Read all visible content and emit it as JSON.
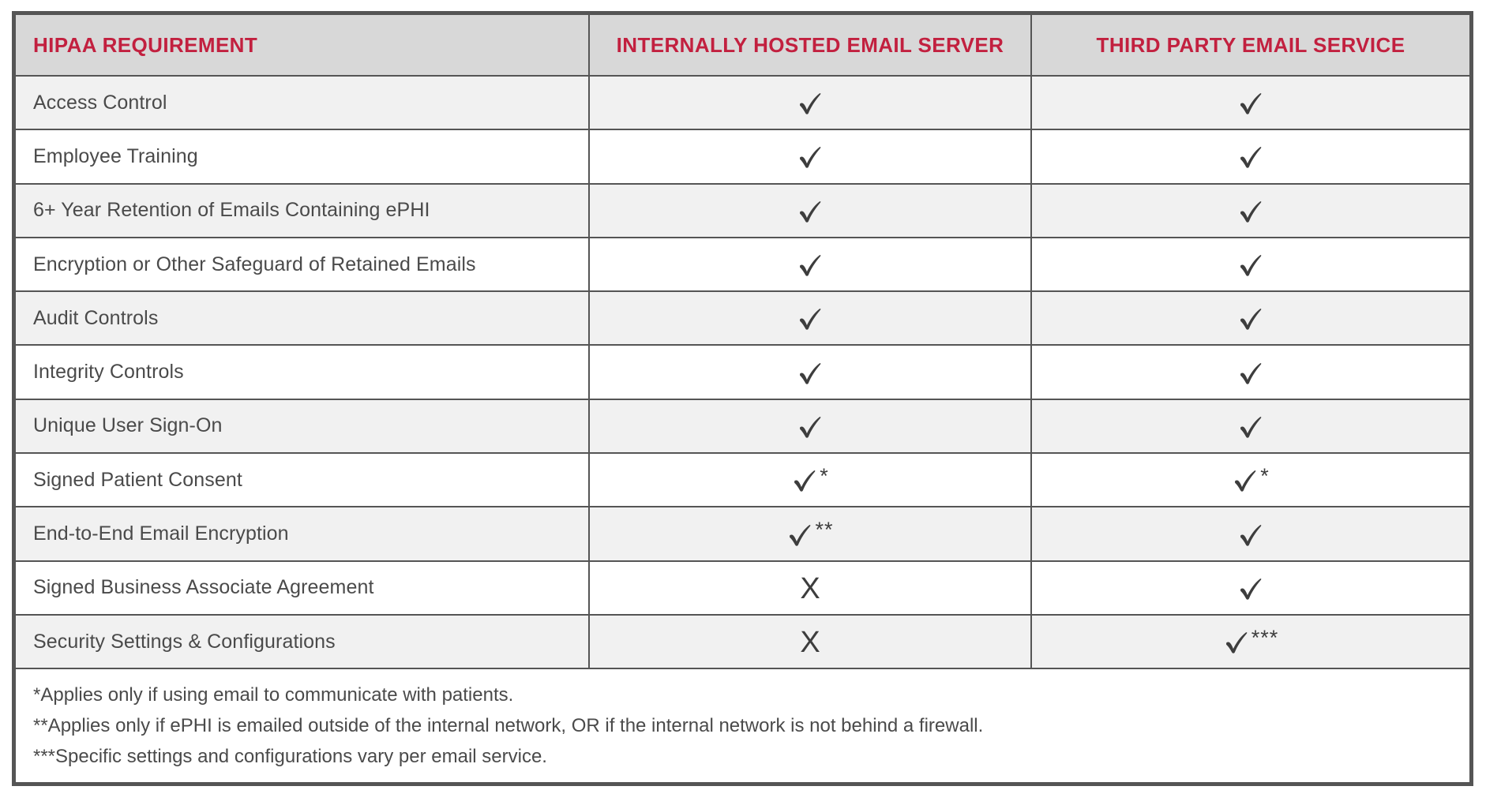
{
  "table": {
    "headers": {
      "requirement": "HIPAA Requirement",
      "internal": "Internally Hosted Email Server",
      "third_party": "Third Party Email Service"
    },
    "header_color": "#c2203f",
    "header_background": "#d8d8d8",
    "border_color": "#555555",
    "stripe_color": "#f1f1f1",
    "mark_color": "#3d3d3d",
    "rows": [
      {
        "requirement": "Access Control",
        "internal": {
          "mark": "check",
          "note": ""
        },
        "third_party": {
          "mark": "check",
          "note": ""
        }
      },
      {
        "requirement": "Employee Training",
        "internal": {
          "mark": "check",
          "note": ""
        },
        "third_party": {
          "mark": "check",
          "note": ""
        }
      },
      {
        "requirement": "6+ Year Retention of Emails Containing ePHI",
        "internal": {
          "mark": "check",
          "note": ""
        },
        "third_party": {
          "mark": "check",
          "note": ""
        }
      },
      {
        "requirement": "Encryption or Other Safeguard of Retained Emails",
        "internal": {
          "mark": "check",
          "note": ""
        },
        "third_party": {
          "mark": "check",
          "note": ""
        }
      },
      {
        "requirement": "Audit Controls",
        "internal": {
          "mark": "check",
          "note": ""
        },
        "third_party": {
          "mark": "check",
          "note": ""
        }
      },
      {
        "requirement": "Integrity Controls",
        "internal": {
          "mark": "check",
          "note": ""
        },
        "third_party": {
          "mark": "check",
          "note": ""
        }
      },
      {
        "requirement": "Unique User Sign-On",
        "internal": {
          "mark": "check",
          "note": ""
        },
        "third_party": {
          "mark": "check",
          "note": ""
        }
      },
      {
        "requirement": "Signed Patient Consent",
        "internal": {
          "mark": "check",
          "note": "*"
        },
        "third_party": {
          "mark": "check",
          "note": "*"
        }
      },
      {
        "requirement": "End-to-End Email Encryption",
        "internal": {
          "mark": "check",
          "note": "**"
        },
        "third_party": {
          "mark": "check",
          "note": ""
        }
      },
      {
        "requirement": "Signed Business Associate Agreement",
        "internal": {
          "mark": "x",
          "note": ""
        },
        "third_party": {
          "mark": "check",
          "note": ""
        }
      },
      {
        "requirement": "Security Settings & Configurations",
        "internal": {
          "mark": "x",
          "note": ""
        },
        "third_party": {
          "mark": "check",
          "note": "***"
        }
      }
    ],
    "footnotes": [
      "*Applies only if using email to communicate with patients.",
      "**Applies only if ePHI is emailed outside of the internal network, OR if the internal network is not behind a firewall.",
      "***Specific settings and configurations vary per email service."
    ],
    "x_glyph": "X"
  }
}
